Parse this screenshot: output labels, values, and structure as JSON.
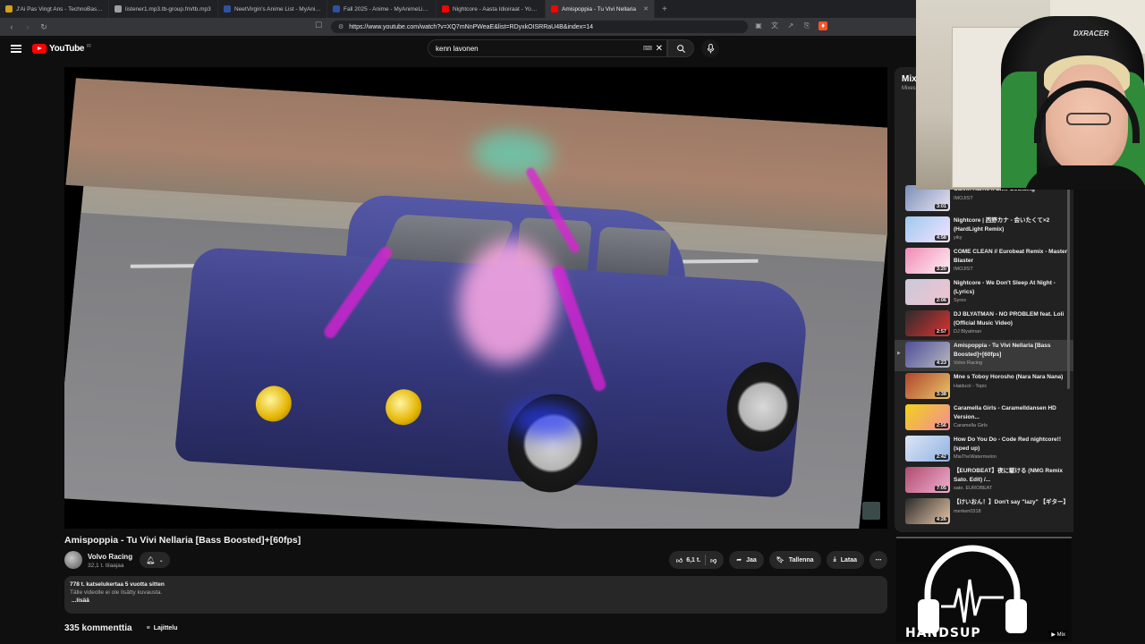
{
  "browser": {
    "tabs": [
      {
        "label": "J'Ai Pas Vingt Ans - TechnoBase.FM",
        "color": "#d4a017"
      },
      {
        "label": "listener1.mp3.tb-group.fm/tb.mp3",
        "color": "#9aa0a6"
      },
      {
        "label": "NeetVirgin's Anime List - MyAnimeL...",
        "color": "#2e51a2"
      },
      {
        "label": "Fall 2025 - Anime - MyAnimeList.net",
        "color": "#2e51a2"
      },
      {
        "label": "Nightcore - Aasta Idioiraat - YouTub...",
        "color": "#ff0000"
      },
      {
        "label": "Amispoppia - Tu Vivi Nellaria",
        "color": "#ff0000"
      }
    ],
    "url": "https://www.youtube.com/watch?v=XQ7mNnPWeaE&list=RDyxkOISRRaU4B&index=14"
  },
  "youtube": {
    "logo_text": "YouTube",
    "region": "FI",
    "search_value": "kenn lavonen"
  },
  "video": {
    "title": "Amispoppia - Tu Vivi Nellaria [Bass Boosted]+[60fps]",
    "channel": "Volvo Racing",
    "subscribers": "32,1 t. tilaajaa",
    "likes": "6,1 t.",
    "share_label": "Jaa",
    "save_label": "Tallenna",
    "download_label": "Lataa",
    "views_and_date": "778 t. katselukertaa  5 vuotta sitten",
    "description": "Tälle videolle ei ole lisätty kuvausta.",
    "more_label": "...lisää",
    "comments_count": "335 kommenttia",
    "sort_label": "Lajittelu"
  },
  "playlist": {
    "title": "Mix",
    "subtitle": "Mixes",
    "items": [
      {
        "name": "Calvin Harris x Ellie Goulding",
        "artist": "IMOJIST",
        "duration": "3:01",
        "color1": "#7a8fb8",
        "color2": "#e9e4f2",
        "current": false
      },
      {
        "name": "Nightcore | 西野カナ - 会いたくて×2 (HardLight Remix)",
        "artist": "yiky",
        "duration": "4:58",
        "color1": "#9ec9f0",
        "color2": "#f3e3ff",
        "current": false
      },
      {
        "name": "COME CLEAN // Eurobeat Remix - Master Blaster",
        "artist": "IMOJIST",
        "duration": "3:20",
        "color1": "#f08ab4",
        "color2": "#fff0f6",
        "current": false
      },
      {
        "name": "Nightcore - We Don't Sleep At Night - (Lyrics)",
        "artist": "Syrex",
        "duration": "2:06",
        "color1": "#c9c9d8",
        "color2": "#f3c3d2",
        "current": false
      },
      {
        "name": "DJ BLYATMAN - NO PROBLEM feat. Loli (Official Music Video)",
        "artist": "DJ Blyatman",
        "duration": "2:57",
        "color1": "#2b2b2b",
        "color2": "#d33",
        "current": false
      },
      {
        "name": "Amispoppia - Tu Vivi Nellaria [Bass Boosted]+[60fps]",
        "artist": "Volvo Racing",
        "duration": "4:23",
        "color1": "#4f4f9a",
        "color2": "#b8b8c0",
        "current": true
      },
      {
        "name": "Mne s Toboy Horosho (Nara Nara Nana)",
        "artist": "Haiducii - Topic",
        "duration": "3:38",
        "color1": "#b0452d",
        "color2": "#e9c66a",
        "current": false
      },
      {
        "name": "Caramella Girls - Caramelldansen HD Version...",
        "artist": "Caramella Girls",
        "duration": "2:56",
        "color1": "#f2d21a",
        "color2": "#f28c9a",
        "current": false
      },
      {
        "name": "How Do You Do - Code Red nightcore!! (sped up)",
        "artist": "MiaTheWatermelon",
        "duration": "2:42",
        "color1": "#dde6f5",
        "color2": "#8fb2e3",
        "current": false
      },
      {
        "name": "【EUROBEAT】夜に駆ける (NMG Remix Sato. Edit) /...",
        "artist": "sato. EUROBEAT",
        "duration": "7:05",
        "color1": "#b04a6f",
        "color2": "#f0b0d0",
        "current": false
      },
      {
        "name": "【けいおん！】Don't say \"lazy\" 【ギター】",
        "artist": "merken0318",
        "duration": "4:26",
        "color1": "#2a2a2a",
        "color2": "#e8c7a8",
        "current": false
      }
    ]
  },
  "webcam": {
    "brand": "DXRACER"
  },
  "mini_player": {
    "label": "HANDSUP",
    "badge": "Mix"
  }
}
